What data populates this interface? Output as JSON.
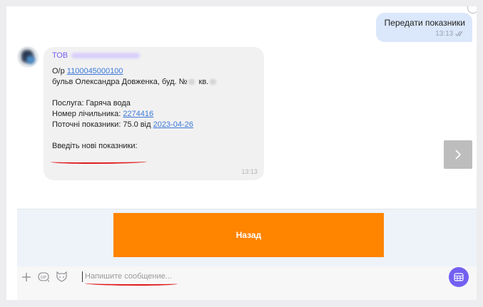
{
  "outgoing": {
    "text": "Передати показники",
    "time": "13:13",
    "status_icon": "double-check-icon"
  },
  "incoming": {
    "sender_prefix": "ТОВ",
    "account_label": "О/р",
    "account_number": "1100045000100",
    "address_prefix": "бульв Олександра Довженка, буд. №",
    "address_apt_label": "кв.",
    "service": "Послуга: Гаряча вода",
    "meter_label": "Номер лічильника:",
    "meter_number": "2274416",
    "reading_label": "Поточні показники: 75.0 від",
    "reading_date": "2023-04-26",
    "prompt": "Введіть нові показники:",
    "time": "13:13"
  },
  "keyboard": {
    "back_label": "Назад"
  },
  "composer": {
    "placeholder": "Напишите сообщение...",
    "icons": [
      "plus-icon",
      "gif-icon",
      "sticker-icon",
      "keyboard-grid-icon"
    ]
  },
  "colors": {
    "accent": "#7360f2",
    "button": "#ff8400",
    "link": "#3c78d8",
    "annotation": "#e0181b"
  }
}
